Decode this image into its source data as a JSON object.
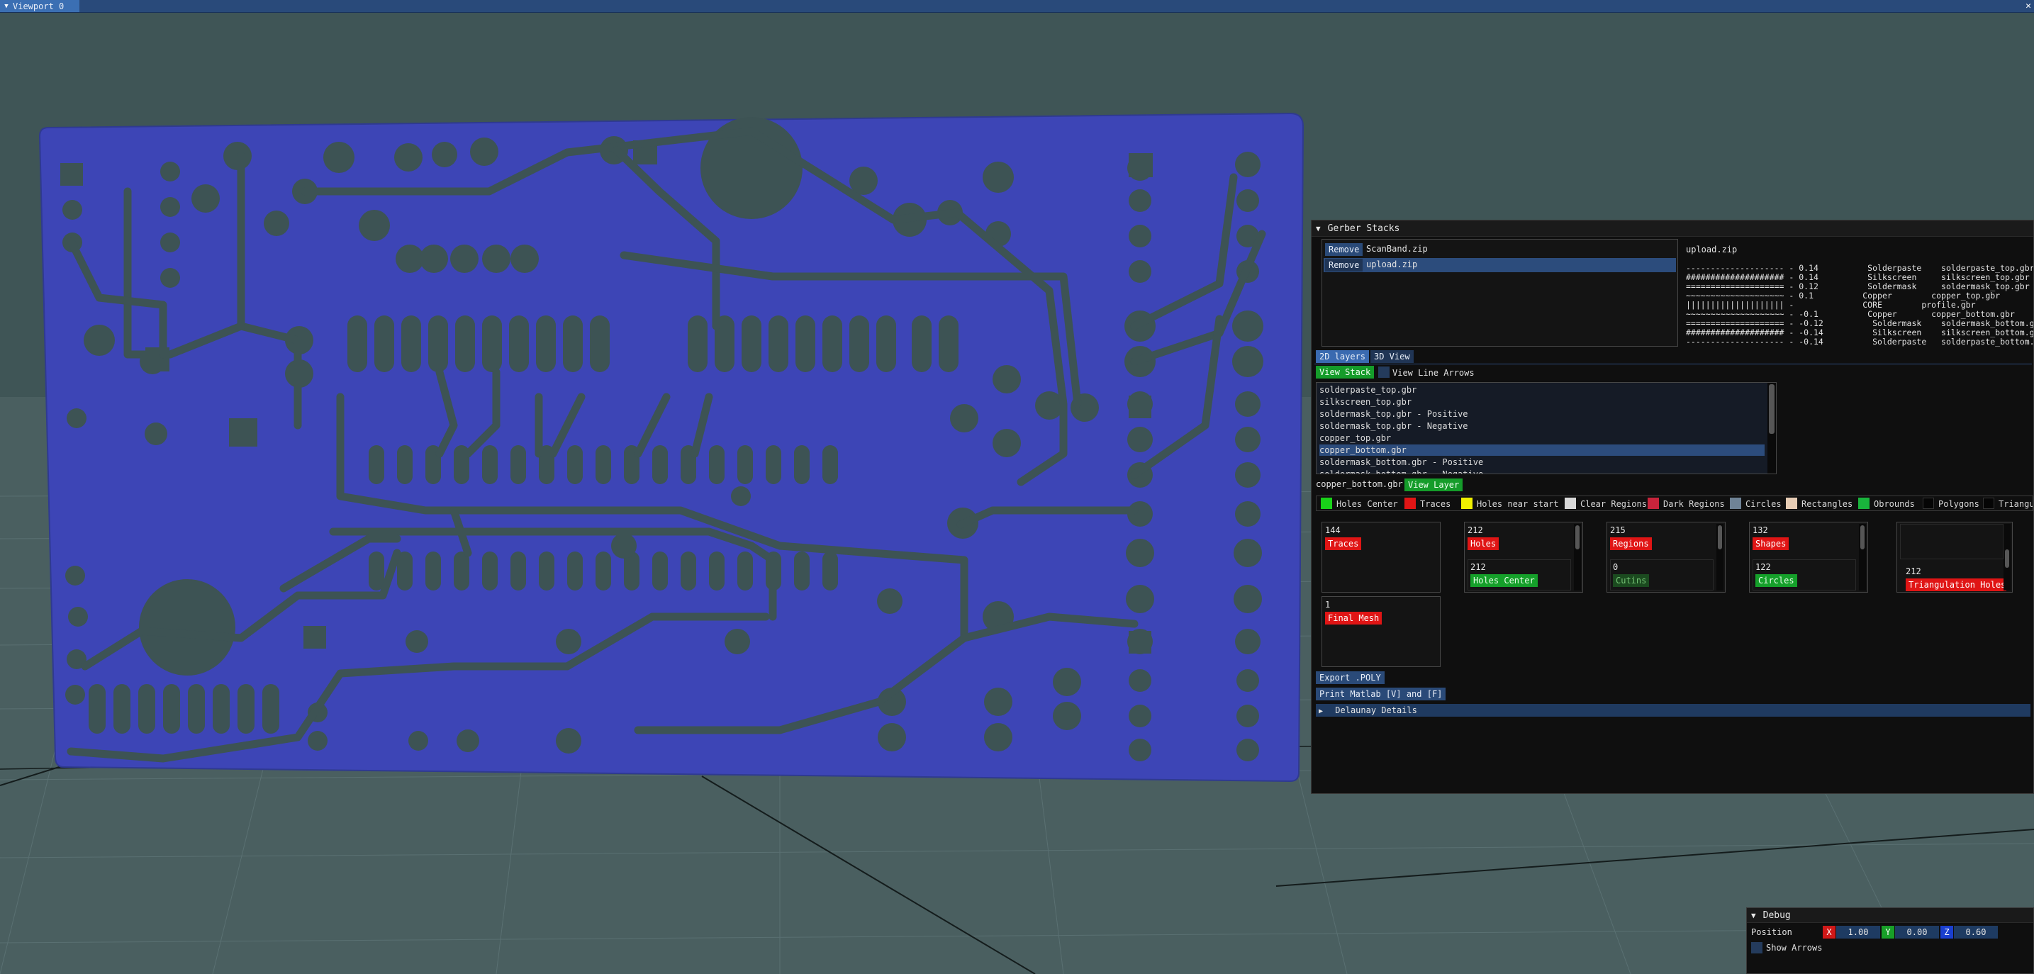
{
  "viewport": {
    "title": "Viewport 0",
    "collapse_icon": "triangle-down-icon",
    "close_icon": "close-icon"
  },
  "board": {
    "fill_color": "#3d45b6",
    "feature_color": "#3d5354"
  },
  "gerber_stacks": {
    "title": "Gerber Stacks",
    "archives": [
      {
        "remove_label": "Remove",
        "name": "ScanBand.zip",
        "selected": false
      },
      {
        "remove_label": "Remove",
        "name": "upload.zip",
        "selected": true
      }
    ],
    "stack_file": "upload.zip",
    "stack_lines": [
      "-------------------- - 0.14          Solderpaste    solderpaste_top.gbr",
      "#################### - 0.14          Silkscreen     silkscreen_top.gbr",
      "==================== - 0.12          Soldermask     soldermask_top.gbr",
      "~~~~~~~~~~~~~~~~~~~~ - 0.1          Copper        copper_top.gbr",
      "|||||||||||||||||||| -              CORE        profile.gbr",
      "~~~~~~~~~~~~~~~~~~~~ - -0.1          Copper       copper_bottom.gbr",
      "==================== - -0.12          Soldermask    soldermask_bottom.gbr",
      "#################### - -0.14          Silkscreen    silkscreen_bottom.gbr",
      "-------------------- - -0.14          Solderpaste   solderpaste_bottom.gbr"
    ],
    "tabs": [
      {
        "label": "2D layers",
        "active": true
      },
      {
        "label": "3D View",
        "active": false
      }
    ],
    "view_stack_button": "View Stack",
    "view_line_arrows_label": "View Line Arrows",
    "layers": [
      {
        "name": "solderpaste_top.gbr",
        "selected": false
      },
      {
        "name": "silkscreen_top.gbr",
        "selected": false
      },
      {
        "name": "soldermask_top.gbr - Positive",
        "selected": false
      },
      {
        "name": "soldermask_top.gbr - Negative",
        "selected": false
      },
      {
        "name": "copper_top.gbr",
        "selected": false
      },
      {
        "name": "copper_bottom.gbr",
        "selected": true
      },
      {
        "name": "soldermask_bottom.gbr - Positive",
        "selected": false
      },
      {
        "name": "soldermask_bottom.gbr - Negative",
        "selected": false
      }
    ],
    "current_layer": "copper_bottom.gbr",
    "view_layer_button": "View Layer",
    "legend": [
      {
        "label": "Holes Center",
        "color": "#19d219"
      },
      {
        "label": "Traces",
        "color": "#e01515"
      },
      {
        "label": "Holes near start",
        "color": "#f0f000"
      },
      {
        "label": "Clear Regions",
        "color": "#d8d8d8"
      },
      {
        "label": "Dark Regions",
        "color": "#c8243c"
      },
      {
        "label": "Circles",
        "color": "#6f8396"
      },
      {
        "label": "Rectangles",
        "color": "#e6ccb4"
      },
      {
        "label": "Obrounds",
        "color": "#19b43c"
      },
      {
        "label": "Polygons",
        "color": "#050505"
      },
      {
        "label": "Triangu",
        "color": "#050505"
      }
    ],
    "cards": [
      {
        "count": "144",
        "label": "Traces",
        "kind": "red",
        "sub_count": "",
        "sub_label": "",
        "sub_kind": ""
      },
      {
        "count": "212",
        "label": "Holes",
        "kind": "red",
        "sub_count": "212",
        "sub_label": "Holes Center",
        "sub_kind": "green"
      },
      {
        "count": "215",
        "label": "Regions",
        "kind": "red",
        "sub_count": "0",
        "sub_label": "Cutins",
        "sub_kind": "dgreen"
      },
      {
        "count": "132",
        "label": "Shapes",
        "kind": "red",
        "sub_count": "122",
        "sub_label": "Circles",
        "sub_kind": "green"
      },
      {
        "count": "",
        "label": "",
        "kind": "",
        "sub_count": "212",
        "sub_label": "Triangulation Holes",
        "sub_kind": "red"
      }
    ],
    "final_mesh": {
      "count": "1",
      "label": "Final Mesh"
    },
    "export_button": "Export .POLY",
    "print_button": "Print Matlab [V] and [F]",
    "delaunay": "Delaunay Details"
  },
  "debug": {
    "title": "Debug",
    "position_label": "Position",
    "x_label": "X",
    "x_value": "1.00",
    "y_label": "Y",
    "y_value": "0.00",
    "z_label": "Z",
    "z_value": "0.60",
    "show_arrows_label": "Show Arrows"
  }
}
